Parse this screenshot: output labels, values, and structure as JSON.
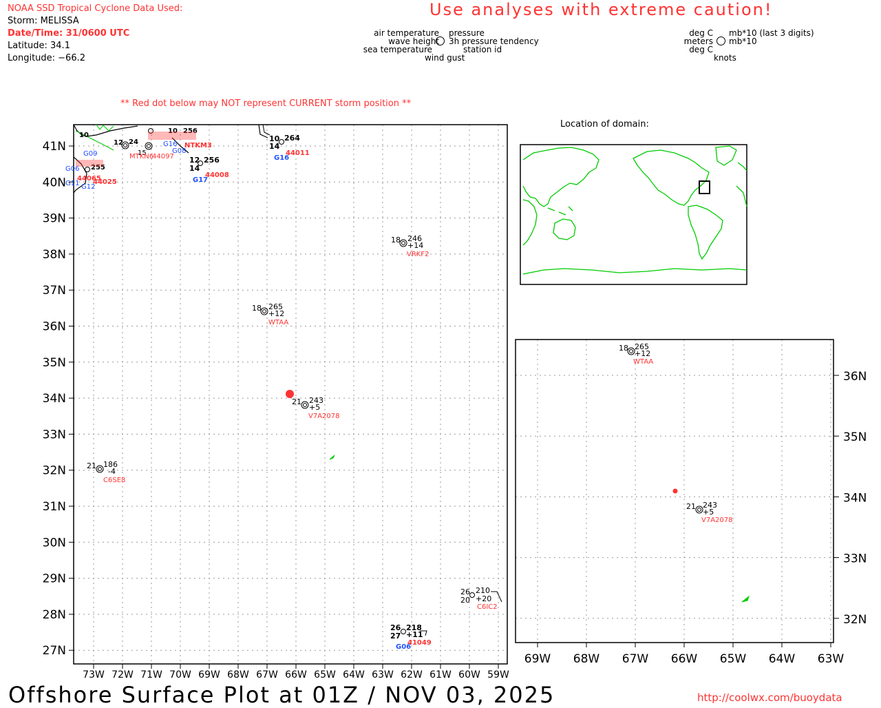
{
  "header": {
    "source_title": "NOAA SSD Tropical Cyclone Data Used:",
    "storm": "Storm: MELISSA",
    "datetime": "Date/Time: 31/0600 UTC",
    "latitude": "Latitude: 34.1",
    "longitude": "Longitude: −66.2",
    "caution": "Use analyses with extreme caution!",
    "red_dot_note": "** Red dot below may NOT represent CURRENT storm position **"
  },
  "legend": {
    "left": {
      "air_temp": "air temperature",
      "pressure": "pressure",
      "wave_height": "wave height",
      "tendency": "3h pressure tendency",
      "sea_temp": "sea temperature",
      "station_id": "station id",
      "wind_gust": "wind gust"
    },
    "right": {
      "air_temp_unit": "deg C",
      "pressure_unit": "mb*10 (last 3 digits)",
      "wave_unit": "meters",
      "tendency_unit": "mb*10",
      "sea_unit": "deg C",
      "gust_unit": "knots"
    }
  },
  "main_map": {
    "lat_labels": [
      "41N",
      "40N",
      "39N",
      "38N",
      "37N",
      "36N",
      "35N",
      "34N",
      "33N",
      "32N",
      "31N",
      "30N",
      "29N",
      "28N",
      "27N"
    ],
    "lon_labels": [
      "73W",
      "72W",
      "71W",
      "70W",
      "69W",
      "68W",
      "67W",
      "66W",
      "65W",
      "64W",
      "63W",
      "62W",
      "61W",
      "60W",
      "59W"
    ]
  },
  "inset": {
    "title": "Location of domain:"
  },
  "zoom_map": {
    "lat_labels": [
      "36N",
      "35N",
      "34N",
      "33N",
      "32N"
    ],
    "lon_labels": [
      "69W",
      "68W",
      "67W",
      "66W",
      "65W",
      "64W",
      "63W"
    ]
  },
  "stations": {
    "vrkf2": {
      "air": "18",
      "pres": "246",
      "tend": "+14",
      "id": "VRKF2"
    },
    "wtaa": {
      "air": "18",
      "pres": "265",
      "tend": "+12",
      "id": "WTAA"
    },
    "v7a2078": {
      "air": "21",
      "pres": "243",
      "tend": "+5",
      "id": "V7A2078"
    },
    "c6se8": {
      "air": "21",
      "pres": "186",
      "tend": "-4",
      "id": "C6SE8"
    },
    "c6ic2": {
      "air": "26",
      "pres": "210",
      "sea": "20",
      "tend": "+20",
      "id": "C6IC2"
    },
    "b41049": {
      "air": "26",
      "pres": "218",
      "sea": "27",
      "tend": "+11",
      "id": "41049",
      "gust": "G06"
    },
    "b44011": {
      "air": "10",
      "pres": "264",
      "wave": "14",
      "id": "44011",
      "gust": "G16"
    },
    "b44008": {
      "air": "12",
      "pres": "256",
      "wave": "14",
      "id": "44008",
      "gust": "G17"
    },
    "b44097": {
      "air": "12",
      "pres": "24",
      "sea": "15",
      "id": "44097",
      "extra": "MTKN6"
    },
    "ntkm3": {
      "id": "NTKM3",
      "pres": "256",
      "air": "10"
    },
    "b44065": {
      "air": "10",
      "pres": "255",
      "id": "44065",
      "extra": "44025",
      "gusts": [
        "G06",
        "G11",
        "G12",
        "G09",
        "G08",
        "G16"
      ]
    }
  },
  "footer": {
    "title": "Offshore Surface Plot at 01Z / NOV 03, 2025",
    "url": "http://coolwx.com/buoydata"
  },
  "colors": {
    "red": "#ff3333",
    "blue": "#1f4fff",
    "green": "#00cc00",
    "grid": "#999999"
  }
}
